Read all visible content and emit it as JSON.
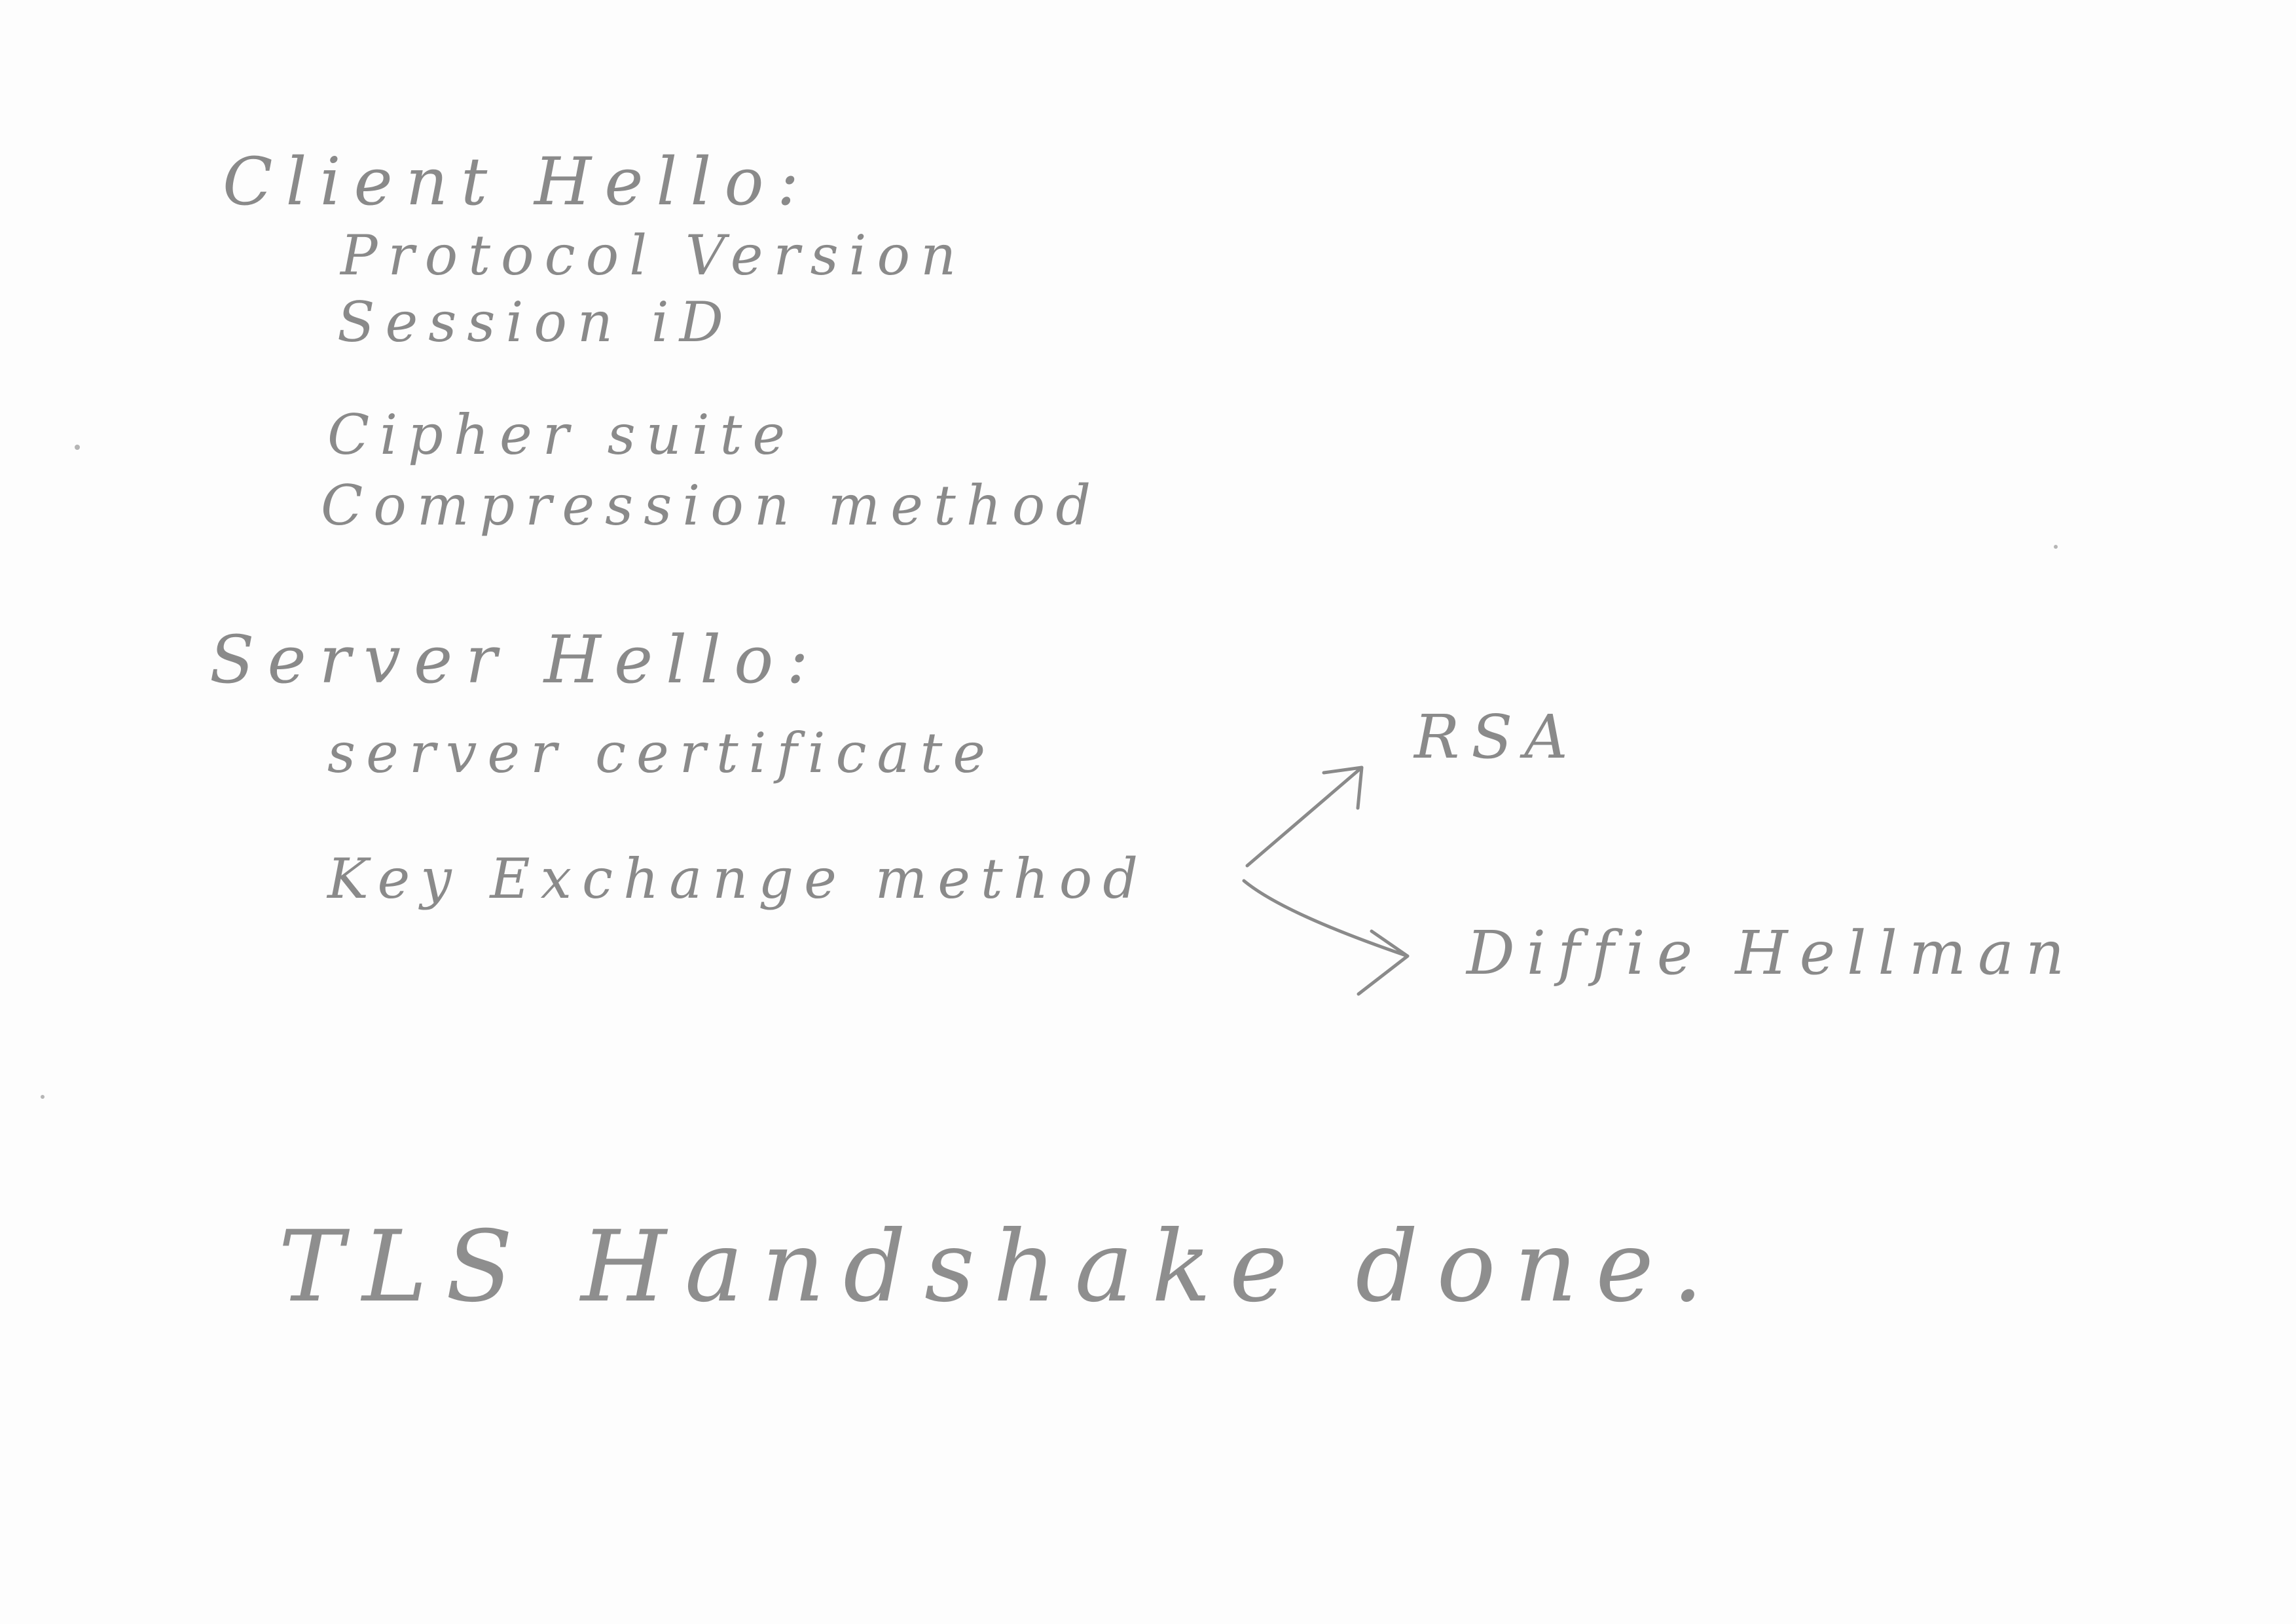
{
  "client_hello": {
    "heading": "Client Hello:",
    "items": [
      "Protocol Version",
      "Session iD",
      "Cipher suite",
      "Compression method"
    ]
  },
  "server_hello": {
    "heading": "Server Hello:",
    "items": [
      "server certificate",
      "Key Exchange method"
    ],
    "key_exchange_options": [
      "RSA",
      "Diffie Hellman"
    ]
  },
  "closing_note": "TLS Handshake done.",
  "colors": {
    "paper": "#fdfdfd",
    "pencil": "#8a8a8a"
  }
}
